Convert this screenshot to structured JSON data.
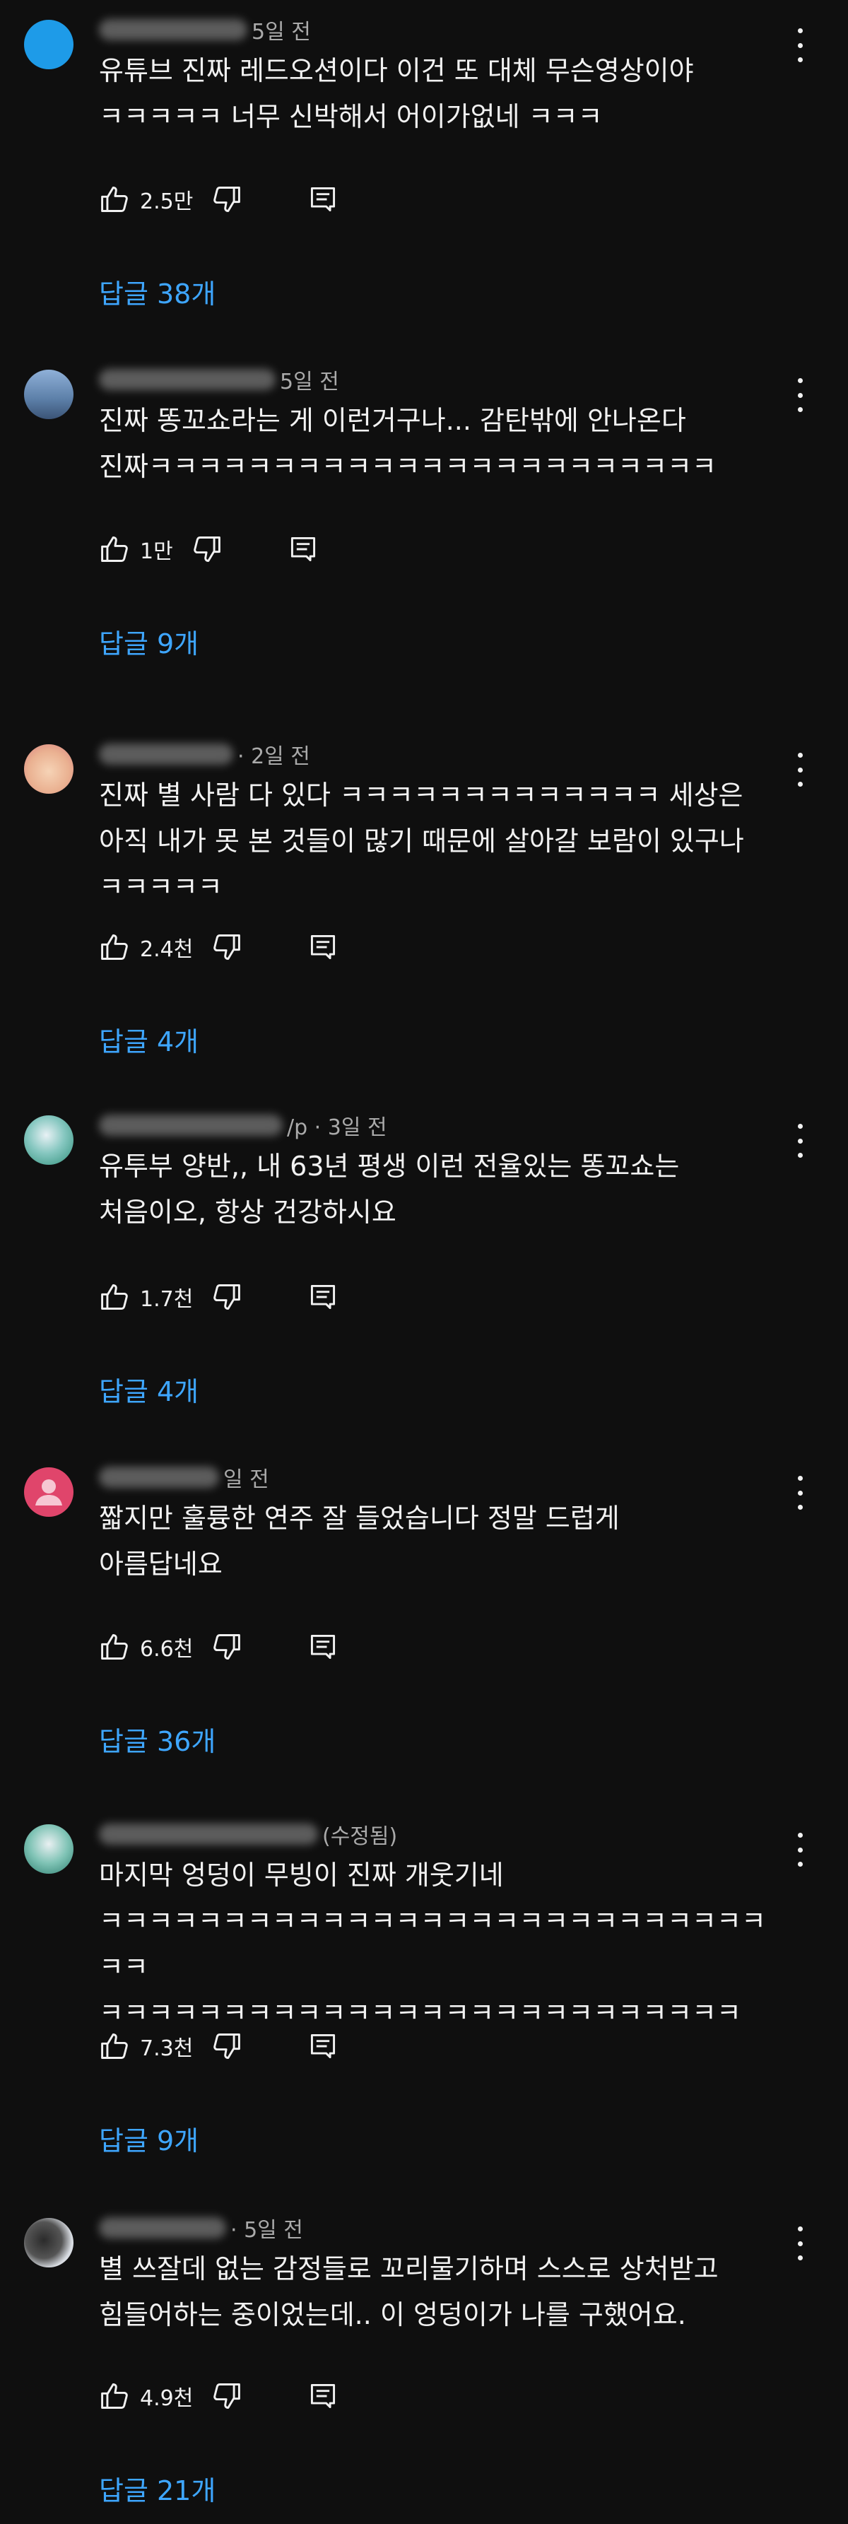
{
  "comments": [
    {
      "meta_suffix": "5일 전",
      "text": "유튜브 진짜 레드오션이다 이건 또 대체 무슨영상이야\nㅋㅋㅋㅋㅋ 너무 신박해서 어이가없네 ㅋㅋㅋ",
      "likes": "2.5만",
      "replies": "답글 38개",
      "avatar_color": "#1e9be8"
    },
    {
      "meta_suffix": "5일 전",
      "text": "진짜 똥꼬쇼라는 게 이런거구나... 감탄밖에 안나온다\n진짜ㅋㅋㅋㅋㅋㅋㅋㅋㅋㅋㅋㅋㅋㅋㅋㅋㅋㅋㅋㅋㅋㅋㅋ",
      "likes": "1만",
      "replies": "답글 9개",
      "avatar_color": "#6f8fb5"
    },
    {
      "meta_suffix": "· 2일 전",
      "text": "진짜 별 사람 다 있다 ㅋㅋㅋㅋㅋㅋㅋㅋㅋㅋㅋㅋㅋ 세상은\n아직 내가 못 본 것들이 많기 때문에 살아갈 보람이 있구나\nㅋㅋㅋㅋㅋ",
      "likes": "2.4천",
      "replies": "답글 4개",
      "avatar_color": "#f2c9a8"
    },
    {
      "meta_suffix": "/p · 3일 전",
      "text": "유투부 양반,, 내 63년 평생 이런 전율있는 똥꼬쇼는\n처음이오, 항상 건강하시요",
      "likes": "1.7천",
      "replies": "답글 4개",
      "avatar_color": "#3aa58a"
    },
    {
      "meta_suffix": "일 전",
      "text": "짧지만 훌륭한 연주 잘 들었습니다 정말 드럽게\n아름답네요",
      "likes": "6.6천",
      "replies": "답글 36개",
      "avatar_color": "#e0456b"
    },
    {
      "meta_suffix": "(수정됨)",
      "text": "마지막 엉덩이 무빙이 진짜 개웃기네\nㅋㅋㅋㅋㅋㅋㅋㅋㅋㅋㅋㅋㅋㅋㅋㅋㅋㅋㅋㅋㅋㅋㅋㅋㅋㅋㅋㅋㅋ\nㅋㅋㅋㅋㅋㅋㅋㅋㅋㅋㅋㅋㅋㅋㅋㅋㅋㅋㅋㅋㅋㅋㅋㅋㅋㅋ",
      "likes": "7.3천",
      "replies": "답글 9개",
      "avatar_color": "#3f9e8c"
    },
    {
      "meta_suffix": "· 5일 전",
      "text": "별 쓰잘데 없는 감정들로 꼬리물기하며 스스로 상처받고\n힘들어하는 중이었는데.. 이 엉덩이가 나를 구했어요.",
      "likes": "4.9천",
      "replies": "답글 21개",
      "avatar_color": "#d9dde3"
    }
  ]
}
